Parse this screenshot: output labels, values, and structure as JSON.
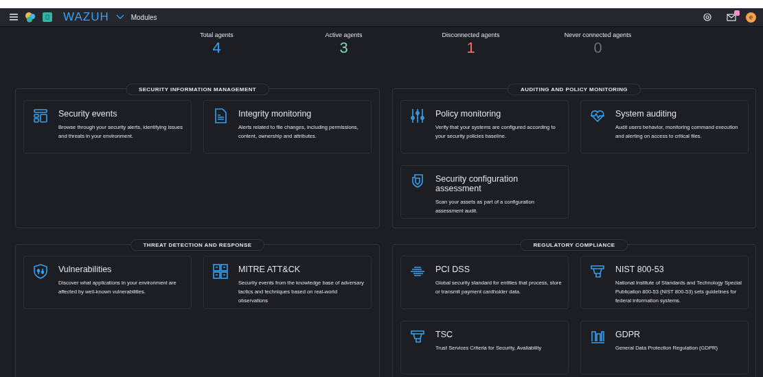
{
  "header": {
    "logo_text": "WAZUH",
    "breadcrumb": "Modules",
    "avatar": "e",
    "notification": true
  },
  "stats": [
    {
      "label": "Total agents",
      "value": "4",
      "color": "#36a2ef"
    },
    {
      "label": "Active agents",
      "value": "3",
      "color": "#7dd3b8"
    },
    {
      "label": "Disconnected agents",
      "value": "1",
      "color": "#f86b63"
    },
    {
      "label": "Never connected agents",
      "value": "0",
      "color": "#6a717d"
    }
  ],
  "sections": [
    {
      "title": "SECURITY INFORMATION MANAGEMENT",
      "cards": [
        {
          "title": "Security events",
          "description": "Browse through your security alerts, identifying issues and threats in your environment."
        },
        {
          "title": "Integrity monitoring",
          "description": "Alerts related to file changes, including permissions, content, ownership and attributes."
        }
      ]
    },
    {
      "title": "AUDITING AND POLICY MONITORING",
      "cards": [
        {
          "title": "Policy monitoring",
          "description": "Verify that your systems are configured according to your security policies baseline."
        },
        {
          "title": "System auditing",
          "description": "Audit users behavior, monitoring command execution and alerting on access to critical files."
        },
        {
          "title": "Security configuration assessment",
          "description": "Scan your assets as part of a configuration assessment audit."
        }
      ]
    },
    {
      "title": "THREAT DETECTION AND RESPONSE",
      "cards": [
        {
          "title": "Vulnerabilities",
          "description": "Discover what applications in your environment are affected by well-known vulnerabilities."
        },
        {
          "title": "MITRE ATT&CK",
          "description": "Security events from the knowledge base of adversary tactics and techniques based on real-world observations"
        }
      ]
    },
    {
      "title": "REGULATORY COMPLIANCE",
      "cards": [
        {
          "title": "PCI DSS",
          "description": "Global security standard for entities that process, store or transmit payment cardholder data."
        },
        {
          "title": "NIST 800-53",
          "description": "National Institute of Standards and Technology Special Publication 800-53 (NIST 800-53) sets guidelines for federal information systems."
        },
        {
          "title": "TSC",
          "description": "Trust Services Criteria for Security, Availability"
        },
        {
          "title": "GDPR",
          "description": "General Data Protection Regulation (GDPR)"
        }
      ]
    }
  ]
}
